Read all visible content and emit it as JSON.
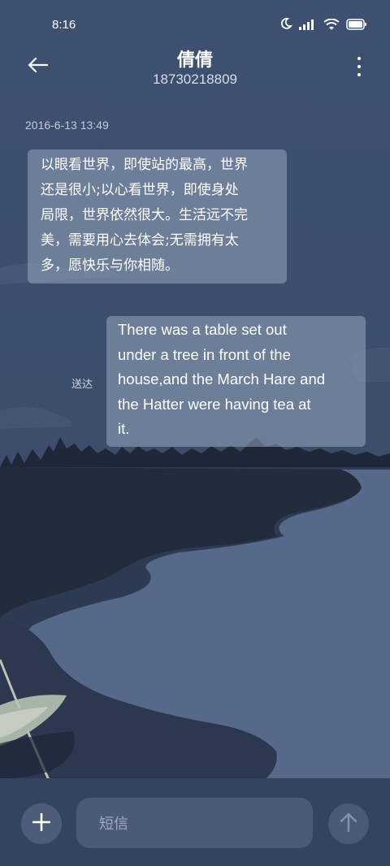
{
  "status": {
    "time": "8:16",
    "icons": [
      "moon-icon",
      "signal-icon",
      "wifi-icon",
      "battery-icon"
    ]
  },
  "header": {
    "contact_name": "倩倩",
    "phone_number": "18730218809"
  },
  "messages": [
    {
      "timestamp": "2016-6-13 13:49",
      "direction": "incoming",
      "lines": [
        "以眼看世界，即使站的最高，世界",
        "还是很小;以心看世界，即使身处",
        "局限，世界依然很大。生活远不完",
        "美，需要用心去体会;无需拥有太",
        "多，愿快乐与你相随。"
      ]
    },
    {
      "direction": "outgoing",
      "status": "送达",
      "lines": [
        "There was a table set out",
        "under a tree in front of the",
        "house,and the March Hare and",
        "the Hatter were having tea at",
        "it."
      ]
    }
  ],
  "composer": {
    "placeholder": "短信"
  },
  "colors": {
    "background": "#3a4c6a",
    "bubble": "#8f9fba",
    "composer": "#34445f"
  }
}
